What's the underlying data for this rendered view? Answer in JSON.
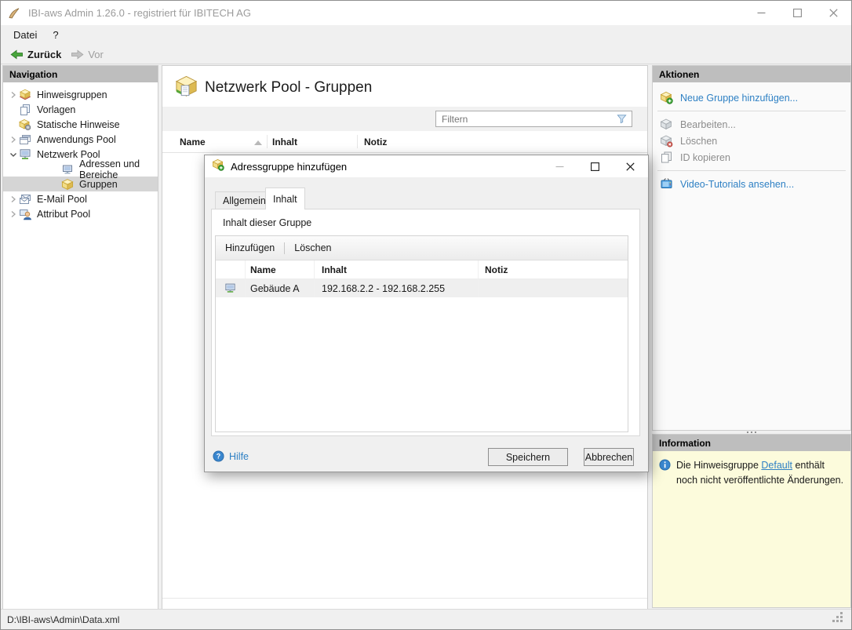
{
  "window": {
    "title": "IBI-aws Admin 1.26.0 - registriert für IBITECH AG"
  },
  "menu": {
    "items": [
      {
        "label": "Datei"
      },
      {
        "label": "?"
      }
    ]
  },
  "toolbar": {
    "back_label": "Zurück",
    "forward_label": "Vor"
  },
  "navigation": {
    "header": "Navigation",
    "items": [
      {
        "label": "Hinweisgruppen"
      },
      {
        "label": "Vorlagen"
      },
      {
        "label": "Statische Hinweise"
      },
      {
        "label": "Anwendungs Pool"
      },
      {
        "label": "Netzwerk Pool"
      },
      {
        "label": "Adressen und Bereiche"
      },
      {
        "label": "Gruppen"
      },
      {
        "label": "E-Mail Pool"
      },
      {
        "label": "Attribut Pool"
      }
    ]
  },
  "main": {
    "title": "Netzwerk Pool - Gruppen",
    "filter_placeholder": "Filtern",
    "columns": [
      "Name",
      "Inhalt",
      "Notiz"
    ]
  },
  "actions": {
    "header": "Aktionen",
    "items": [
      {
        "label": "Neue Gruppe hinzufügen..."
      },
      {
        "label": "Bearbeiten..."
      },
      {
        "label": "Löschen"
      },
      {
        "label": "ID kopieren"
      },
      {
        "label": "Video-Tutorials ansehen..."
      }
    ]
  },
  "information": {
    "header": "Information",
    "message_before": "Die Hinweisgruppe ",
    "message_link": "Default",
    "message_after": " enthält noch nicht veröffentlichte Änderungen."
  },
  "dialog": {
    "title": "Adressgruppe hinzufügen",
    "tabs": [
      {
        "label": "Allgemein"
      },
      {
        "label": "Inhalt"
      }
    ],
    "active_tab": "Inhalt",
    "content_label": "Inhalt dieser Gruppe",
    "list_toolbar": {
      "add_label": "Hinzufügen",
      "delete_label": "Löschen"
    },
    "columns": [
      "Name",
      "Inhalt",
      "Notiz"
    ],
    "rows": [
      {
        "name": "Gebäude A",
        "content": "192.168.2.2 - 192.168.2.255",
        "note": ""
      }
    ],
    "help_label": "Hilfe",
    "save_label": "Speichern",
    "cancel_label": "Abbrechen"
  },
  "statusbar": {
    "path": "D:\\IBI-aws\\Admin\\Data.xml"
  },
  "colors": {
    "link_blue": "#2e80c4",
    "info_panel_bg": "#fcfbdc",
    "panel_header_bg": "#bebebe",
    "selected_tree_bg": "#d5d5d5",
    "back_arrow_green": "#49a63c"
  }
}
